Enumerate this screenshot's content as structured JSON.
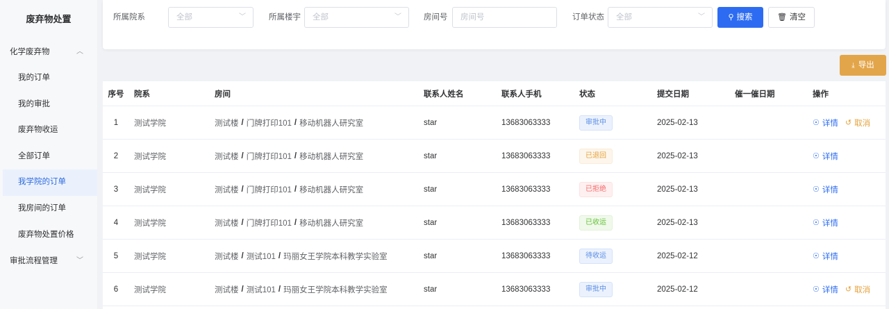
{
  "sidebar": {
    "title": "废弃物处置",
    "group1": "化学废弃物",
    "items": [
      "我的订单",
      "我的审批",
      "废弃物收运",
      "全部订单",
      "我学院的订单",
      "我房间的订单",
      "废弃物处置价格"
    ],
    "group2": "审批流程管理"
  },
  "filters": {
    "college_label": "所属院系",
    "college_placeholder": "全部",
    "building_label": "所属楼宇",
    "building_placeholder": "全部",
    "room_label": "房间号",
    "room_placeholder": "房间号",
    "status_label": "订单状态",
    "status_placeholder": "全部",
    "search_label": "搜索",
    "clear_label": "清空"
  },
  "export_label": "导出",
  "table": {
    "headers": [
      "序号",
      "院系",
      "房间",
      "联系人姓名",
      "联系人手机",
      "状态",
      "提交日期",
      "催一催日期",
      "操作"
    ],
    "rows": [
      {
        "idx": "1",
        "college": "测试学院",
        "room": [
          "测试楼",
          "门牌打印101",
          "移动机器人研究室"
        ],
        "name": "star",
        "phone": "13683063333",
        "status": "审批中",
        "date": "2025-02-13",
        "detail": "详情",
        "cancel": "取消"
      },
      {
        "idx": "2",
        "college": "测试学院",
        "room": [
          "测试楼",
          "门牌打印101",
          "移动机器人研究室"
        ],
        "name": "star",
        "phone": "13683063333",
        "status": "已退回",
        "date": "2025-02-13",
        "detail": "详情"
      },
      {
        "idx": "3",
        "college": "测试学院",
        "room": [
          "测试楼",
          "门牌打印101",
          "移动机器人研究室"
        ],
        "name": "star",
        "phone": "13683063333",
        "status": "已拒绝",
        "date": "2025-02-13",
        "detail": "详情"
      },
      {
        "idx": "4",
        "college": "测试学院",
        "room": [
          "测试楼",
          "门牌打印101",
          "移动机器人研究室"
        ],
        "name": "star",
        "phone": "13683063333",
        "status": "已收运",
        "date": "2025-02-13",
        "detail": "详情"
      },
      {
        "idx": "5",
        "college": "测试学院",
        "room": [
          "测试楼",
          "测试101",
          "玛丽女王学院本科教学实验室"
        ],
        "name": "star",
        "phone": "13683063333",
        "status": "待收运",
        "date": "2025-02-12",
        "detail": "详情"
      },
      {
        "idx": "6",
        "college": "测试学院",
        "room": [
          "测试楼",
          "测试101",
          "玛丽女王学院本科教学实验室"
        ],
        "name": "star",
        "phone": "13683063333",
        "status": "审批中",
        "date": "2025-02-12",
        "detail": "详情",
        "cancel": "取消"
      }
    ]
  },
  "colors": {
    "primary": "#2d6cf2",
    "warning": "#e6a23c",
    "export_bg": "#e3a54a",
    "active_menu_bg": "#eaf1fd"
  }
}
